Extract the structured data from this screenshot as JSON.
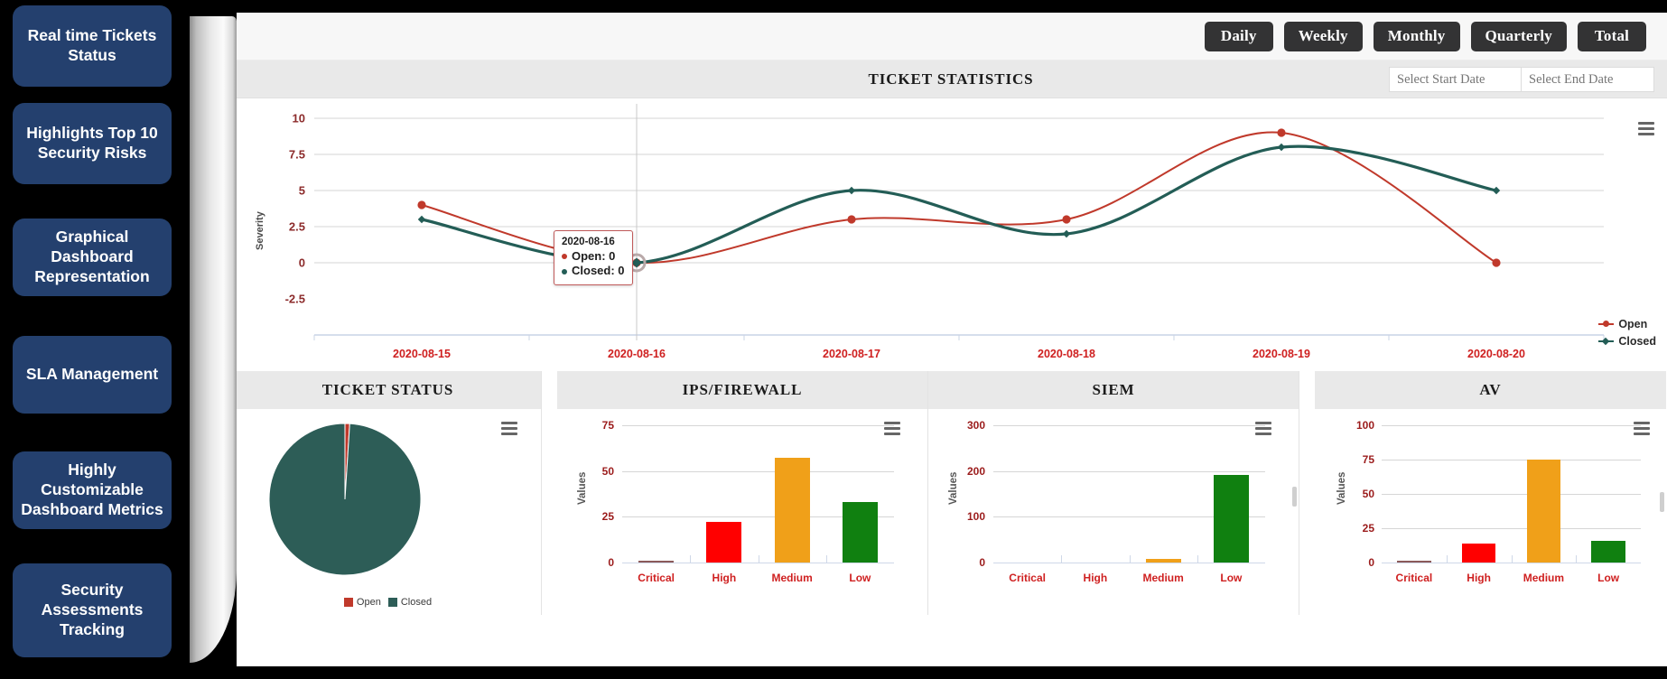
{
  "sidebar": {
    "items": [
      {
        "label": "Real time Tickets Status"
      },
      {
        "label": "Highlights Top 10 Security Risks"
      },
      {
        "label": "Graphical Dashboard Representation"
      },
      {
        "label": "SLA Management"
      },
      {
        "label": "Highly Customizable Dashboard Metrics"
      },
      {
        "label": "Security Assessments Tracking"
      }
    ]
  },
  "toolbar": {
    "buttons": [
      {
        "label": "Daily"
      },
      {
        "label": "Weekly"
      },
      {
        "label": "Monthly"
      },
      {
        "label": "Quarterly"
      },
      {
        "label": "Total"
      }
    ]
  },
  "ticket_statistics": {
    "title": "TICKET STATISTICS",
    "start_date_placeholder": "Select Start Date",
    "end_date_placeholder": "Select End Date",
    "start_date_value": "",
    "end_date_value": "",
    "menu_icon": "hamburger-menu-icon",
    "tooltip": {
      "date": "2020-08-16",
      "open_line": "Open: 0",
      "closed_line": "Closed: 0"
    }
  },
  "panels": {
    "ticket_status": {
      "title": "TICKET STATUS",
      "menu_icon": "hamburger-menu-icon"
    },
    "ips_firewall": {
      "title": "IPS/FIREWALL",
      "menu_icon": "hamburger-menu-icon"
    },
    "siem": {
      "title": "SIEM",
      "menu_icon": "hamburger-menu-icon"
    },
    "av": {
      "title": "AV",
      "menu_icon": "hamburger-menu-icon"
    }
  },
  "colors": {
    "open": "#c0392b",
    "closed": "#235d56",
    "critical": "#8b5a5a",
    "high": "#ff0000",
    "medium": "#f0a019",
    "low": "#108010",
    "brand_navy": "#24406e",
    "axis_red": "#cf2020"
  },
  "chart_data": [
    {
      "id": "ticket-statistics-line",
      "type": "line",
      "title": "TICKET STATISTICS",
      "xlabel": "",
      "ylabel": "Severity",
      "x": [
        "2020-08-15",
        "2020-08-16",
        "2020-08-17",
        "2020-08-18",
        "2020-08-19",
        "2020-08-20"
      ],
      "ylim": [
        -2.5,
        10
      ],
      "yticks": [
        -2.5,
        0,
        2.5,
        5,
        7.5,
        10
      ],
      "ytick_labels": [
        "-2.5",
        "0",
        "2.5",
        "5",
        "7.5",
        "10"
      ],
      "grid": true,
      "legend_position": "right",
      "series": [
        {
          "name": "Open",
          "color": "#c0392b",
          "values": [
            4,
            0,
            3,
            3,
            9,
            0
          ]
        },
        {
          "name": "Closed",
          "color": "#235d56",
          "values": [
            3,
            0,
            5,
            2,
            8,
            5
          ]
        }
      ]
    },
    {
      "id": "ticket-status-pie",
      "type": "pie",
      "title": "TICKET STATUS",
      "labels": [
        "Open",
        "Closed"
      ],
      "values": [
        1,
        99
      ],
      "colors": [
        "#c0392b",
        "#2d5d57"
      ],
      "legend_position": "bottom"
    },
    {
      "id": "ips-firewall-bar",
      "type": "bar",
      "title": "IPS/FIREWALL",
      "xlabel": "",
      "ylabel": "Values",
      "categories": [
        "Critical",
        "High",
        "Medium",
        "Low"
      ],
      "values": [
        0.5,
        22,
        57,
        33
      ],
      "colors": [
        "#8b5a5a",
        "#ff0000",
        "#f0a019",
        "#108010"
      ],
      "ylim": [
        0,
        75
      ],
      "yticks": [
        0,
        25,
        50,
        75
      ],
      "grid": true
    },
    {
      "id": "siem-bar",
      "type": "bar",
      "title": "SIEM",
      "xlabel": "",
      "ylabel": "Values",
      "categories": [
        "Critical",
        "High",
        "Medium",
        "Low"
      ],
      "values": [
        0,
        0,
        8,
        192
      ],
      "colors": [
        "#8b5a5a",
        "#ff0000",
        "#f0a019",
        "#108010"
      ],
      "ylim": [
        0,
        300
      ],
      "yticks": [
        0,
        100,
        200,
        300
      ],
      "grid": true
    },
    {
      "id": "av-bar",
      "type": "bar",
      "title": "AV",
      "xlabel": "",
      "ylabel": "Values",
      "categories": [
        "Critical",
        "High",
        "Medium",
        "Low"
      ],
      "values": [
        0.5,
        14,
        75,
        16
      ],
      "colors": [
        "#8b5a5a",
        "#ff0000",
        "#f0a019",
        "#108010"
      ],
      "ylim": [
        0,
        100
      ],
      "yticks": [
        0,
        25,
        50,
        75,
        100
      ],
      "grid": true
    }
  ]
}
